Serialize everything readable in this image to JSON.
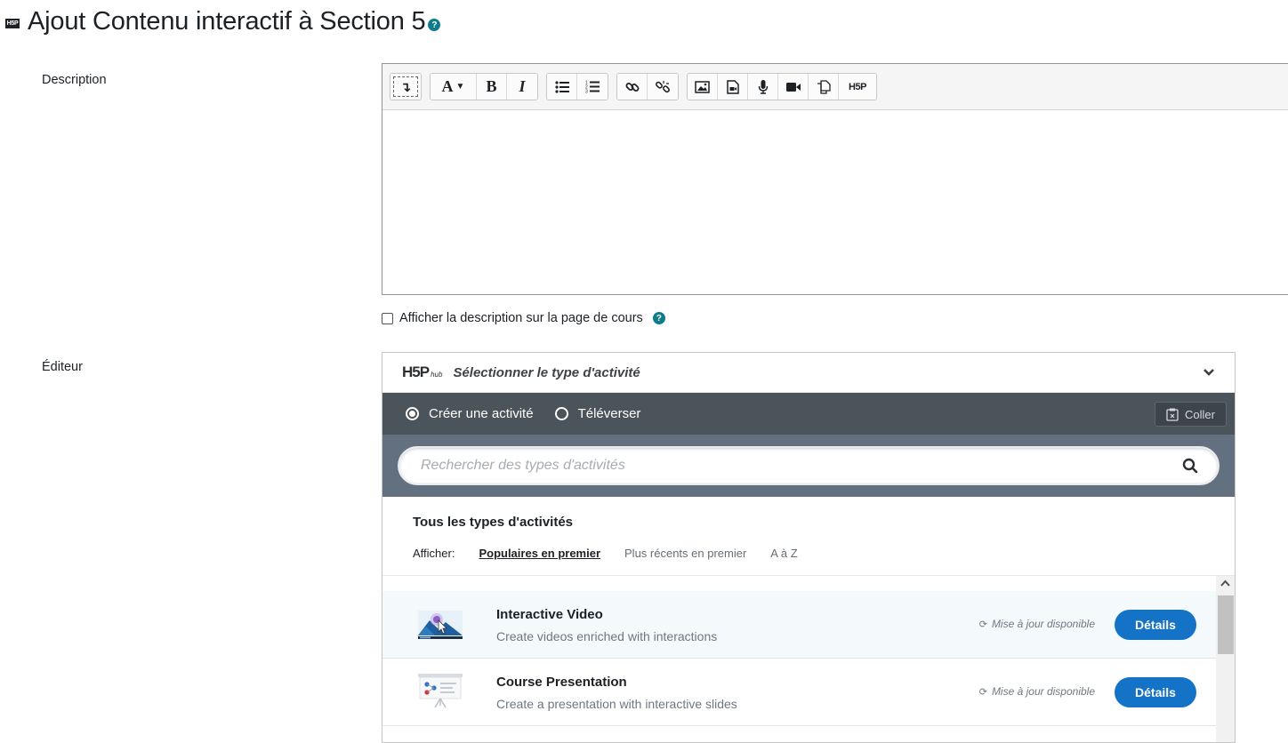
{
  "page": {
    "title": "Ajout Contenu interactif à Section 5",
    "logo_text": "H5P"
  },
  "description": {
    "label": "Description",
    "toolbar_groups": [
      [
        {
          "icon": "collapse-toolbar-icon",
          "glyph": "↴"
        }
      ],
      [
        {
          "icon": "font-format-icon",
          "glyph": "A ▾"
        },
        {
          "icon": "bold-icon",
          "glyph": "B"
        },
        {
          "icon": "italic-icon",
          "glyph": "I"
        }
      ],
      [
        {
          "icon": "bullet-list-icon"
        },
        {
          "icon": "numbered-list-icon"
        }
      ],
      [
        {
          "icon": "link-icon"
        },
        {
          "icon": "unlink-icon"
        }
      ],
      [
        {
          "icon": "image-icon"
        },
        {
          "icon": "media-icon"
        },
        {
          "icon": "microphone-icon"
        },
        {
          "icon": "video-camera-icon"
        },
        {
          "icon": "manage-files-icon"
        },
        {
          "icon": "h5p-icon",
          "glyph": "H5P"
        }
      ]
    ],
    "show_on_course_page": "Afficher la description sur la page de cours",
    "checked": false
  },
  "editor": {
    "label": "Éditeur",
    "hub_logo": "H5P",
    "hub_logo_sub": "hub",
    "select_label": "Sélectionner le type d'activité",
    "tabs": [
      {
        "label": "Créer une activité",
        "selected": true
      },
      {
        "label": "Téléverser",
        "selected": false
      }
    ],
    "paste_label": "Coller",
    "search_placeholder": "Rechercher des types d'activités",
    "types_title": "Tous les types d'activités",
    "sort_label": "Afficher:",
    "sort_options": [
      {
        "label": "Populaires en premier",
        "active": true
      },
      {
        "label": "Plus récents en premier",
        "active": false
      },
      {
        "label": "A à Z",
        "active": false
      }
    ],
    "items": [
      {
        "title": "Interactive Video",
        "description": "Create videos enriched with interactions",
        "update": "Mise à jour disponible",
        "button": "Détails",
        "icon": "interactive-video-icon"
      },
      {
        "title": "Course Presentation",
        "description": "Create a presentation with interactive slides",
        "update": "Mise à jour disponible",
        "button": "Détails",
        "icon": "course-presentation-icon"
      }
    ]
  },
  "colors": {
    "accent_blue": "#1473c7",
    "help_teal": "#0f7d89",
    "hub_tabs_bg": "#4b535b",
    "search_band_bg": "#637080"
  }
}
